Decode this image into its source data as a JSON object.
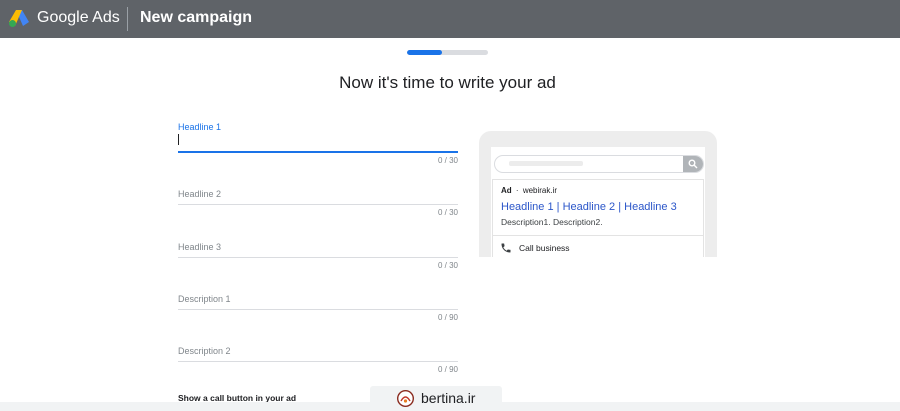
{
  "header": {
    "brand": "Google Ads",
    "page_title": "New campaign",
    "logo_icon": "google-ads-logo"
  },
  "progress": {
    "fraction": 0.43
  },
  "main": {
    "heading": "Now it's time to write your ad"
  },
  "form": {
    "fields": [
      {
        "label": "Headline 1",
        "value": "",
        "counter": "0 / 30",
        "focused": true
      },
      {
        "label": "Headline 2",
        "value": "",
        "counter": "0 / 30",
        "focused": false
      },
      {
        "label": "Headline 3",
        "value": "",
        "counter": "0 / 30",
        "focused": false
      },
      {
        "label": "Description 1",
        "value": "",
        "counter": "0 / 90",
        "focused": false
      },
      {
        "label": "Description 2",
        "value": "",
        "counter": "0 / 90",
        "focused": false
      }
    ],
    "call_toggle_label": "Show a call button in your ad"
  },
  "preview": {
    "search_icon": "search-icon",
    "ad_badge": "Ad",
    "ad_separator": "·",
    "ad_domain": "webirak.ir",
    "headline": "Headline 1 | Headline 2 | Headline 3",
    "description": "Description1. Description2.",
    "call_icon": "phone-icon",
    "call_label": "Call business"
  },
  "watermark": {
    "text": "bertina.ir"
  },
  "colors": {
    "header_bg": "#5f6368",
    "accent": "#1a73e8",
    "ad_headline": "#2b56c9"
  }
}
